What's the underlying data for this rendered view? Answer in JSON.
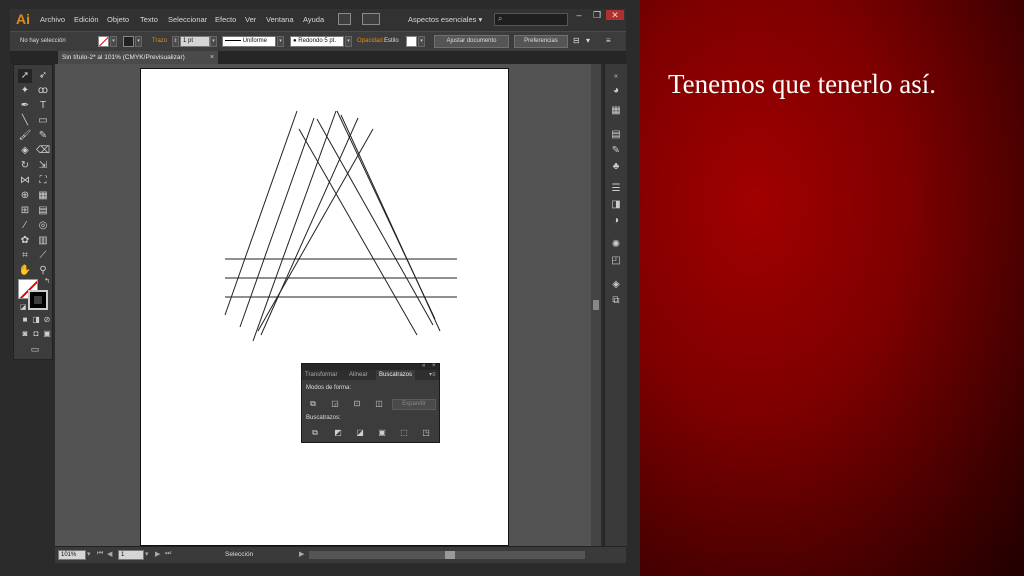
{
  "app": {
    "logo": "Ai",
    "menu": [
      "Archivo",
      "Edición",
      "Objeto",
      "Texto",
      "Seleccionar",
      "Efecto",
      "Ver",
      "Ventana",
      "Ayuda"
    ],
    "workspace": "Aspectos esenciales",
    "window_controls": [
      "–",
      "❐",
      "✕"
    ]
  },
  "control_bar": {
    "selection_status": "No hay selección",
    "stroke_label": "Trazo",
    "stroke_weight": "1 pt",
    "stroke_profile": "Uniforme",
    "brush": "Redondo 5 pt.",
    "opacity_label": "Opacidad",
    "style_label": "Estilo",
    "fit_document_button": "Ajustar documento",
    "preferences_button": "Preferencias"
  },
  "document_tab": {
    "title": "Sin título-2* al 101% (CMYK/Previsualizar)",
    "close": "×"
  },
  "status_bar": {
    "zoom": "101%",
    "artboard_number": "1",
    "current_tool": "Selección"
  },
  "pathfinder_panel": {
    "tabs": [
      "Transformar",
      "Alinear",
      "Buscatrazos"
    ],
    "active_tab": "Buscatrazos",
    "shape_modes_label": "Modos de forma:",
    "expand_button": "Expandir",
    "pathfinders_label": "Buscatrazos:"
  },
  "slide": {
    "text": "Tenemos que tenerlo así."
  },
  "colors": {
    "accent_orange": "#e58b18",
    "slide_red": "#a10000",
    "ui_dark": "#3c3c3c"
  },
  "icons": {
    "search": "search-icon",
    "selection_tool": "selection-arrow-icon",
    "type_tool": "type-tool-icon",
    "hand_tool": "hand-icon",
    "zoom_tool": "zoom-icon"
  }
}
